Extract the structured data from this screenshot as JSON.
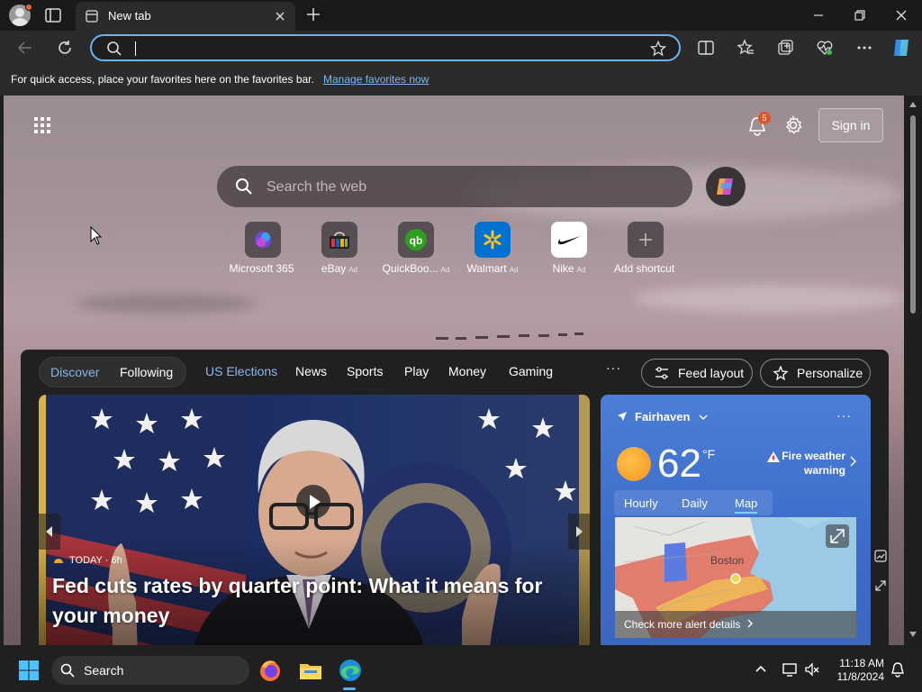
{
  "browser": {
    "tab_title": "New tab",
    "address_value": "",
    "favorites_bar": {
      "message": "For quick access, place your favorites here on the favorites bar.",
      "link": "Manage favorites now"
    }
  },
  "newtab": {
    "notification_count": "5",
    "signin_label": "Sign in",
    "search_placeholder": "Search the web",
    "shortcuts": [
      {
        "label": "Microsoft 365",
        "ad": ""
      },
      {
        "label": "eBay",
        "ad": "Ad"
      },
      {
        "label": "QuickBoo...",
        "ad": "Ad"
      },
      {
        "label": "Walmart",
        "ad": "Ad"
      },
      {
        "label": "Nike",
        "ad": "Ad"
      },
      {
        "label": "Add shortcut",
        "ad": ""
      }
    ],
    "feed_nav": {
      "discover": "Discover",
      "following": "Following",
      "items": [
        "US Elections",
        "News",
        "Sports",
        "Play",
        "Money",
        "Gaming"
      ],
      "more": "···",
      "feed_layout": "Feed layout",
      "personalize": "Personalize"
    },
    "hero": {
      "source": "TODAY",
      "age": "· 6h",
      "title": "Fed cuts rates by quarter point: What it means for your money"
    },
    "weather": {
      "location": "Fairhaven",
      "temperature": "62",
      "unit": "°F",
      "alert": "Fire weather warning",
      "tabs": [
        "Hourly",
        "Daily",
        "Map"
      ],
      "active_tab": "Map",
      "map_city": "Boston",
      "footer": "Check more alert details"
    }
  },
  "taskbar": {
    "search_label": "Search",
    "time": "11:18 AM",
    "date": "11/8/2024"
  },
  "colors": {
    "accent": "#6cb1f3",
    "link": "#7fb8f0",
    "weather_bg": "#4c7ed7",
    "badge": "#e0552b"
  }
}
